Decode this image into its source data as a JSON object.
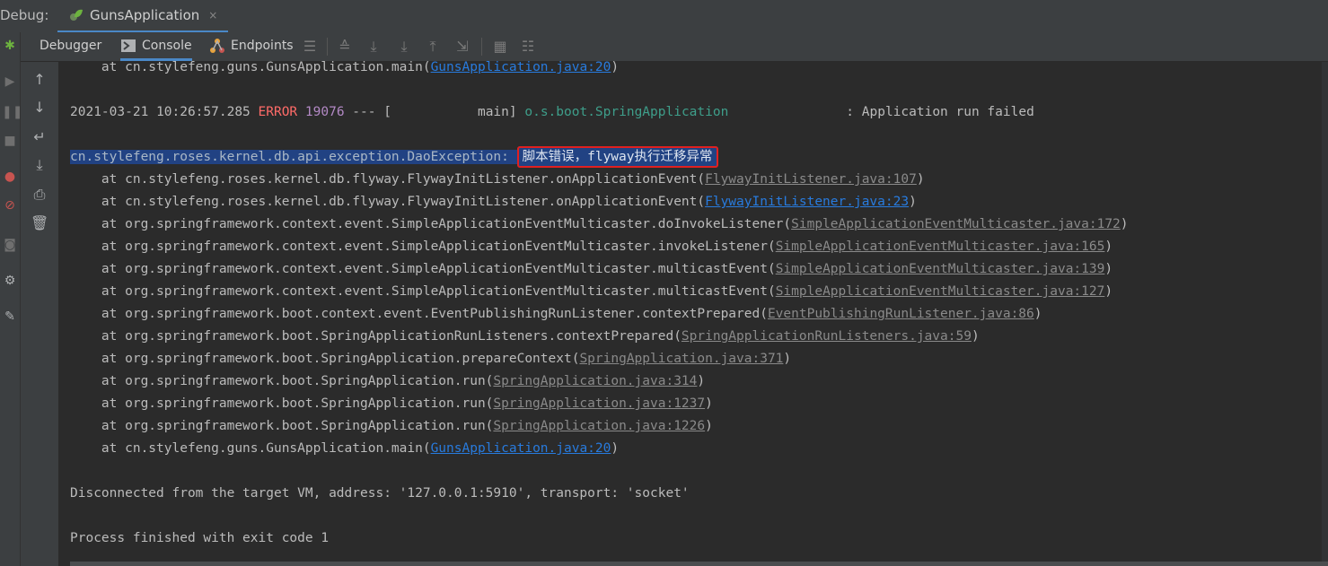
{
  "title_bar": {
    "label": "Debug:",
    "run_tab": "GunsApplication",
    "close_glyph": "×"
  },
  "toolbar": {
    "debugger": "Debugger",
    "console": "Console",
    "endpoints": "Endpoints"
  },
  "console": {
    "l0": {
      "prefix": "    at cn.stylefeng.guns.GunsApplication.main(",
      "link": "GunsApplication.java:20",
      "suffix": ")"
    },
    "log": {
      "timestamp": "2021-03-21 10:26:57.285 ",
      "level": "ERROR",
      "pid": " 19076",
      "thread": " --- [           main] ",
      "logger": "o.s.boot.SpringApplication",
      "message": "               : Application run failed"
    },
    "exc": {
      "name": "cn.stylefeng.roses.kernel.db.api.exception.DaoException: ",
      "message": "脚本错误，flyway执行迁移异常"
    },
    "stack": [
      {
        "prefix": "    at cn.stylefeng.roses.kernel.db.flyway.FlywayInitListener.onApplicationEvent(",
        "link": "FlywayInitListener.java:107",
        "suffix": ")"
      },
      {
        "prefix": "    at cn.stylefeng.roses.kernel.db.flyway.FlywayInitListener.onApplicationEvent(",
        "link": "FlywayInitListener.java:23",
        "suffix": ")"
      },
      {
        "prefix": "    at org.springframework.context.event.SimpleApplicationEventMulticaster.doInvokeListener(",
        "link": "SimpleApplicationEventMulticaster.java:172",
        "suffix": ")"
      },
      {
        "prefix": "    at org.springframework.context.event.SimpleApplicationEventMulticaster.invokeListener(",
        "link": "SimpleApplicationEventMulticaster.java:165",
        "suffix": ")"
      },
      {
        "prefix": "    at org.springframework.context.event.SimpleApplicationEventMulticaster.multicastEvent(",
        "link": "SimpleApplicationEventMulticaster.java:139",
        "suffix": ")"
      },
      {
        "prefix": "    at org.springframework.context.event.SimpleApplicationEventMulticaster.multicastEvent(",
        "link": "SimpleApplicationEventMulticaster.java:127",
        "suffix": ")"
      },
      {
        "prefix": "    at org.springframework.boot.context.event.EventPublishingRunListener.contextPrepared(",
        "link": "EventPublishingRunListener.java:86",
        "suffix": ")"
      },
      {
        "prefix": "    at org.springframework.boot.SpringApplicationRunListeners.contextPrepared(",
        "link": "SpringApplicationRunListeners.java:59",
        "suffix": ")"
      },
      {
        "prefix": "    at org.springframework.boot.SpringApplication.prepareContext(",
        "link": "SpringApplication.java:371",
        "suffix": ")"
      },
      {
        "prefix": "    at org.springframework.boot.SpringApplication.run(",
        "link": "SpringApplication.java:314",
        "suffix": ")"
      },
      {
        "prefix": "    at org.springframework.boot.SpringApplication.run(",
        "link": "SpringApplication.java:1237",
        "suffix": ")"
      },
      {
        "prefix": "    at org.springframework.boot.SpringApplication.run(",
        "link": "SpringApplication.java:1226",
        "suffix": ")"
      },
      {
        "prefix": "    at cn.stylefeng.guns.GunsApplication.main(",
        "link": "GunsApplication.java:20",
        "suffix": ")"
      }
    ],
    "disconnected": "Disconnected from the target VM, address: '127.0.0.1:5910', transport: 'socket'",
    "finished": "Process finished with exit code 1"
  },
  "colors": {
    "background": "#2b2b2b",
    "panel": "#3c3f41",
    "error": "#ff6b68",
    "link": "#287bde",
    "selection": "#214283",
    "highlight_box": "#e02020",
    "tab_accent": "#4a88c7"
  },
  "icons": {
    "run_tab": "spring-leaf-icon",
    "left_strip": [
      "debug-bug-icon",
      "resume-icon",
      "pause-icon",
      "stop-icon",
      "breakpoints-icon",
      "mute-breakpoints-icon",
      "camera-icon",
      "settings-icon",
      "pin-icon"
    ],
    "toolbar": [
      "endpoints-icon",
      "menu-icon",
      "show-execution-point-icon",
      "step-over-icon",
      "step-into-icon",
      "step-out-icon",
      "run-to-cursor-icon",
      "evaluate-icon",
      "trace-icon"
    ],
    "side": [
      "up-arrow-icon",
      "down-arrow-icon",
      "soft-wrap-icon",
      "scroll-to-end-icon",
      "print-icon",
      "trash-icon"
    ]
  }
}
